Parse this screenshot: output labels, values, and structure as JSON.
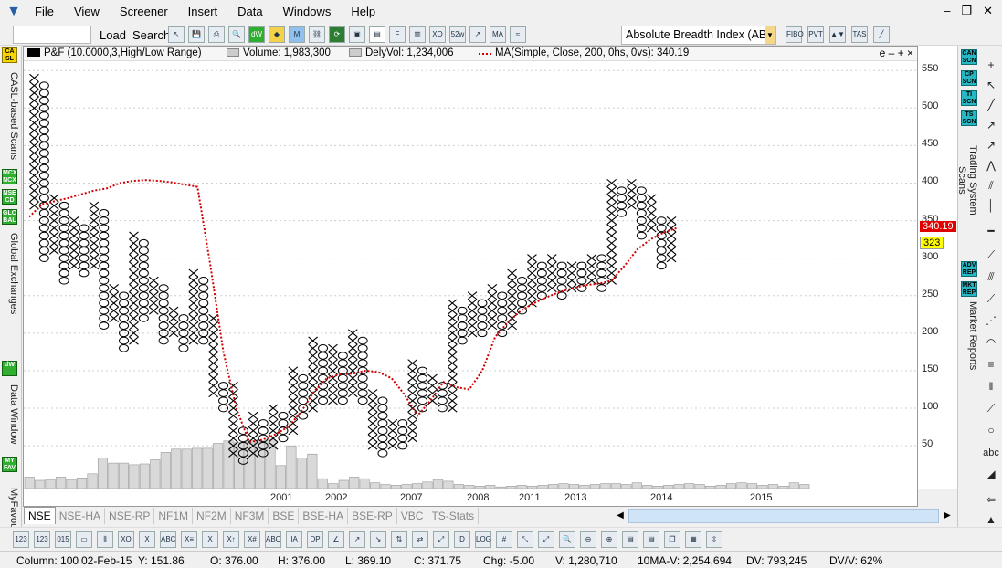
{
  "menubar": {
    "items": [
      "File",
      "View",
      "Screener",
      "Insert",
      "Data",
      "Windows",
      "Help"
    ]
  },
  "toolbar": {
    "load_label": "Load",
    "search_label": "Search",
    "study_value": "Absolute Breadth Index (ABI"
  },
  "left_tabs": [
    {
      "badge": "CA SL",
      "label": "CASL-based Scans"
    },
    {
      "badge": "MCX NCX",
      "label": ""
    },
    {
      "badge": "NSE CD",
      "label": ""
    },
    {
      "badge": "GLO BAL",
      "label": "Global Exchanges"
    },
    {
      "badge": "dW",
      "label": "Data Window"
    },
    {
      "badge": "MY FAV",
      "label": "MyFavourit"
    }
  ],
  "right_tabs": [
    {
      "badge": "CAN SCN",
      "label": ""
    },
    {
      "badge": "CP SCN",
      "label": ""
    },
    {
      "badge": "TI SCN",
      "label": ""
    },
    {
      "badge": "TS SCN",
      "label": "Trading System Scans"
    },
    {
      "badge": "ADV REP",
      "label": ""
    },
    {
      "badge": "MKT REP",
      "label": "Market Reports"
    }
  ],
  "legend": {
    "pnf": "P&F (10.0000,3,High/Low Range)",
    "volume": "Volume: 1,983,300",
    "delyvol": "DelyVol: 1,234,006",
    "ma": "MA(Simple, Close, 200, 0hs, 0vs): 340.19",
    "controls": "e – + ×"
  },
  "price_axis": {
    "ticks": [
      "550",
      "500",
      "450",
      "400",
      "350",
      "300",
      "250",
      "200",
      "150",
      "100",
      "50"
    ],
    "ma_label": "340.19",
    "last_label": "323"
  },
  "x_axis": {
    "ticks": [
      "2001",
      "2002",
      "2007",
      "2008",
      "2011",
      "2013",
      "2014",
      "2015"
    ]
  },
  "sheet_tabs": [
    "NSE",
    "NSE-HA",
    "NSE-RP",
    "NF1M",
    "NF2M",
    "NF3M",
    "BSE",
    "BSE-HA",
    "BSE-RP",
    "VBC",
    "TS-Stats"
  ],
  "status": {
    "column": "Column: 100",
    "date": "02-Feb-15",
    "y": "Y: 151.86",
    "o": "O: 376.00",
    "h": "H: 376.00",
    "l": "L: 369.10",
    "c": "C: 371.75",
    "chg": "Chg: -5.00",
    "v": "V: 1,280,710",
    "mav": "10MA-V: 2,254,694",
    "dv": "DV: 793,245",
    "dvv": "DV/V: 62%"
  },
  "colors": {
    "ma_line": "#d00000",
    "ma_label_bg": "#e00000",
    "last_label_bg": "#ffff00",
    "volume_bar": "#d9d9d9"
  },
  "chart_data": {
    "type": "point-and-figure",
    "box_size": 10,
    "reversal": 3,
    "ylim": [
      10,
      560
    ],
    "columns": [
      {
        "t": "X",
        "lo": 370,
        "hi": 540
      },
      {
        "t": "O",
        "lo": 300,
        "hi": 530
      },
      {
        "t": "X",
        "lo": 310,
        "hi": 380
      },
      {
        "t": "O",
        "lo": 270,
        "hi": 370
      },
      {
        "t": "X",
        "lo": 290,
        "hi": 350
      },
      {
        "t": "O",
        "lo": 280,
        "hi": 340
      },
      {
        "t": "X",
        "lo": 290,
        "hi": 370
      },
      {
        "t": "O",
        "lo": 210,
        "hi": 360
      },
      {
        "t": "X",
        "lo": 220,
        "hi": 260
      },
      {
        "t": "O",
        "lo": 180,
        "hi": 250
      },
      {
        "t": "X",
        "lo": 190,
        "hi": 330
      },
      {
        "t": "O",
        "lo": 220,
        "hi": 320
      },
      {
        "t": "X",
        "lo": 230,
        "hi": 270
      },
      {
        "t": "O",
        "lo": 190,
        "hi": 260
      },
      {
        "t": "X",
        "lo": 200,
        "hi": 230
      },
      {
        "t": "O",
        "lo": 180,
        "hi": 220
      },
      {
        "t": "X",
        "lo": 190,
        "hi": 280
      },
      {
        "t": "O",
        "lo": 190,
        "hi": 270
      },
      {
        "t": "X",
        "lo": 120,
        "hi": 220
      },
      {
        "t": "O",
        "lo": 100,
        "hi": 130
      },
      {
        "t": "X",
        "lo": 40,
        "hi": 130
      },
      {
        "t": "O",
        "lo": 30,
        "hi": 70
      },
      {
        "t": "X",
        "lo": 40,
        "hi": 90
      },
      {
        "t": "O",
        "lo": 40,
        "hi": 80
      },
      {
        "t": "X",
        "lo": 50,
        "hi": 100
      },
      {
        "t": "O",
        "lo": 60,
        "hi": 90
      },
      {
        "t": "X",
        "lo": 70,
        "hi": 150
      },
      {
        "t": "O",
        "lo": 90,
        "hi": 140
      },
      {
        "t": "X",
        "lo": 100,
        "hi": 190
      },
      {
        "t": "O",
        "lo": 110,
        "hi": 180
      },
      {
        "t": "X",
        "lo": 110,
        "hi": 180
      },
      {
        "t": "O",
        "lo": 110,
        "hi": 170
      },
      {
        "t": "X",
        "lo": 120,
        "hi": 200
      },
      {
        "t": "O",
        "lo": 110,
        "hi": 190
      },
      {
        "t": "X",
        "lo": 50,
        "hi": 120
      },
      {
        "t": "O",
        "lo": 40,
        "hi": 110
      },
      {
        "t": "X",
        "lo": 50,
        "hi": 80
      },
      {
        "t": "O",
        "lo": 50,
        "hi": 80
      },
      {
        "t": "X",
        "lo": 60,
        "hi": 160
      },
      {
        "t": "O",
        "lo": 100,
        "hi": 150
      },
      {
        "t": "X",
        "lo": 110,
        "hi": 140
      },
      {
        "t": "O",
        "lo": 100,
        "hi": 130
      },
      {
        "t": "X",
        "lo": 100,
        "hi": 240
      },
      {
        "t": "O",
        "lo": 190,
        "hi": 230
      },
      {
        "t": "X",
        "lo": 200,
        "hi": 250
      },
      {
        "t": "O",
        "lo": 200,
        "hi": 240
      },
      {
        "t": "X",
        "lo": 210,
        "hi": 260
      },
      {
        "t": "O",
        "lo": 200,
        "hi": 250
      },
      {
        "t": "X",
        "lo": 210,
        "hi": 280
      },
      {
        "t": "O",
        "lo": 230,
        "hi": 270
      },
      {
        "t": "X",
        "lo": 240,
        "hi": 300
      },
      {
        "t": "O",
        "lo": 250,
        "hi": 290
      },
      {
        "t": "X",
        "lo": 260,
        "hi": 300
      },
      {
        "t": "O",
        "lo": 250,
        "hi": 290
      },
      {
        "t": "X",
        "lo": 260,
        "hi": 290
      },
      {
        "t": "O",
        "lo": 260,
        "hi": 290
      },
      {
        "t": "X",
        "lo": 270,
        "hi": 300
      },
      {
        "t": "O",
        "lo": 260,
        "hi": 300
      },
      {
        "t": "X",
        "lo": 270,
        "hi": 400
      },
      {
        "t": "O",
        "lo": 360,
        "hi": 390
      },
      {
        "t": "X",
        "lo": 370,
        "hi": 400
      },
      {
        "t": "O",
        "lo": 330,
        "hi": 390
      },
      {
        "t": "X",
        "lo": 340,
        "hi": 380
      },
      {
        "t": "O",
        "lo": 290,
        "hi": 350
      },
      {
        "t": "X",
        "lo": 300,
        "hi": 350
      }
    ],
    "ma": [
      355,
      372,
      376,
      380,
      385,
      390,
      393,
      400,
      403,
      404,
      403,
      401,
      398,
      395,
      290,
      175,
      100,
      55,
      58,
      65,
      75,
      95,
      122,
      140,
      145,
      146,
      150,
      148,
      140,
      118,
      90,
      110,
      135,
      128,
      125,
      150,
      195,
      215,
      230,
      240,
      248,
      255,
      260,
      264,
      266,
      270,
      290,
      312,
      325,
      334,
      340
    ],
    "volume": [
      14,
      10,
      11,
      14,
      11,
      13,
      18,
      37,
      31,
      31,
      29,
      30,
      35,
      44,
      48,
      48,
      49,
      49,
      55,
      58,
      56,
      58,
      58,
      60,
      28,
      52,
      37,
      42,
      12,
      6,
      10,
      14,
      12,
      7,
      5,
      4,
      5,
      6,
      8,
      11,
      9,
      5,
      4,
      3,
      4,
      2,
      3,
      4,
      3,
      4,
      5,
      6,
      5,
      4,
      5,
      6,
      6,
      5,
      7,
      4,
      3,
      4,
      5,
      6,
      5,
      3,
      4,
      6,
      7,
      6,
      4,
      5,
      3,
      7,
      5
    ]
  }
}
